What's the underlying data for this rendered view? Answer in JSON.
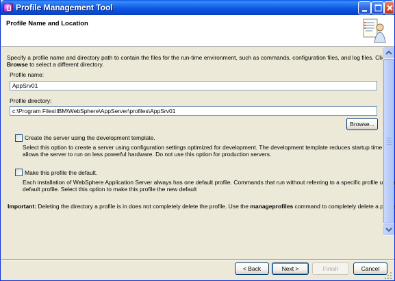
{
  "window": {
    "title": "Profile Management Tool"
  },
  "header": {
    "page_title": "Profile Name and Location"
  },
  "intro": {
    "line1": "Specify a profile name and directory path to contain the files for the run-time environment, such as commands, configuration files, and log files. Click",
    "line2_bold": "Browse",
    "line2_rest": " to select a different directory."
  },
  "profile_name": {
    "label": "Profile name:",
    "value": "AppSrv01"
  },
  "profile_directory": {
    "label": "Profile directory:",
    "value": "c:\\Program Files\\IBM\\WebSphere\\AppServer\\profiles\\AppSrv01"
  },
  "browse_button": "Browse...",
  "dev_template": {
    "label": "Create the server using the development template.",
    "checked": false,
    "desc1": "Select this option to create a server using configuration settings optimized for development. The development template reduces startup time and",
    "desc2": "allows the server to run on less powerful hardware. Do not use this option for production servers."
  },
  "default_profile": {
    "label": "Make this profile the default.",
    "checked": false,
    "desc1": "Each installation of WebSphere Application Server always has one default profile. Commands that run without referring to a specific profile use the",
    "desc2": "default profile. Select this option to make this profile the new default"
  },
  "important": {
    "label": "Important:",
    "text1": " Deleting the directory a profile is in does not completely delete the profile. Use the ",
    "command": "manageprofiles",
    "text2": " command to completely delete a profile."
  },
  "buttons": {
    "back": "< Back",
    "next": "Next >",
    "finish": "Finish",
    "cancel": "Cancel"
  },
  "colors": {
    "titlebar": "#0a5ce9",
    "dialog_bg": "#ece9d8",
    "header_bg": "#ffffff",
    "input_border": "#7f9db9"
  }
}
